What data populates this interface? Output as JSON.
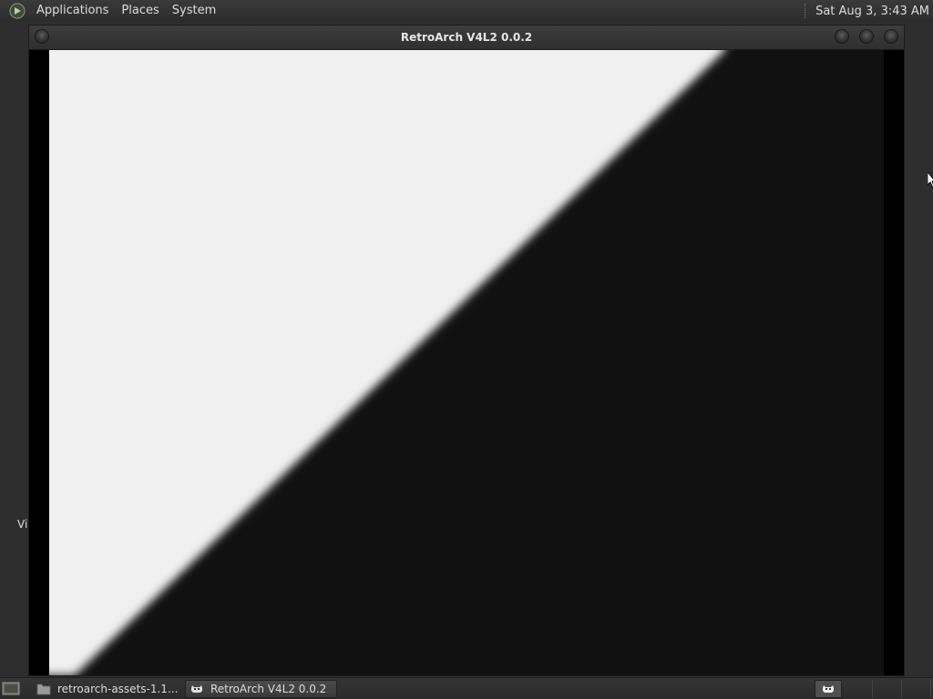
{
  "top_panel": {
    "logo_icon": "distro-logo-icon",
    "menus": [
      "Applications",
      "Places",
      "System"
    ],
    "clock": "Sat Aug  3,  3:43 AM"
  },
  "desktop": {
    "icon_label": "Vi"
  },
  "window": {
    "title": "RetroArch V4L2 0.0.2",
    "content": "v4l2 camera feed: diagonal white/black split"
  },
  "bottom_panel": {
    "tasks": [
      {
        "label": "retroarch-assets-1.1...",
        "icon": "folder-icon",
        "active": false
      },
      {
        "label": "RetroArch V4L2 0.0.2",
        "icon": "retroarch-icon",
        "active": true
      }
    ],
    "tray_icon": "retroarch-icon"
  }
}
